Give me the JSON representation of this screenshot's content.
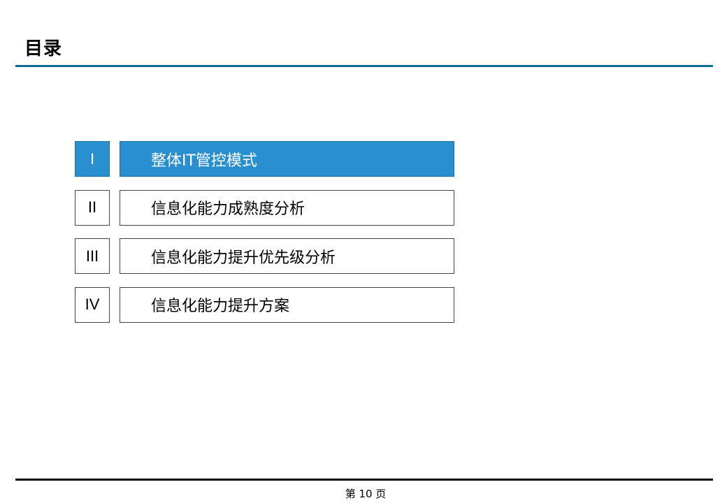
{
  "header": {
    "title": "目录"
  },
  "toc": {
    "items": [
      {
        "numeral": "I",
        "label": "整体IT管控模式",
        "active": true
      },
      {
        "numeral": "II",
        "label": "信息化能力成熟度分析",
        "active": false
      },
      {
        "numeral": "III",
        "label": "信息化能力提升优先级分析",
        "active": false
      },
      {
        "numeral": "IV",
        "label": "信息化能力提升方案",
        "active": false
      }
    ]
  },
  "footer": {
    "page_label": "第 10 页"
  },
  "colors": {
    "accent": "#2a8fcf",
    "rule": "#0e6b94"
  }
}
